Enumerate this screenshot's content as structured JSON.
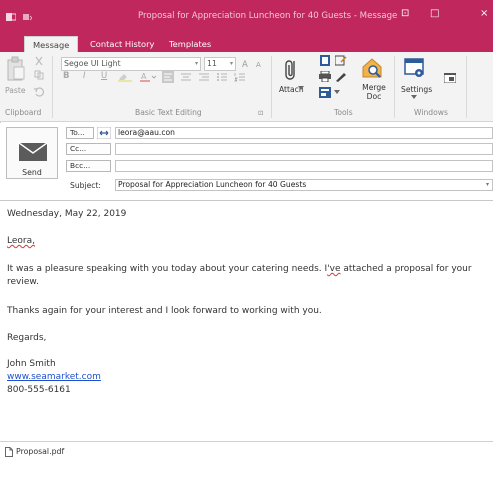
{
  "window": {
    "title": "Proposal for Appreciation Luncheon for 40 Guests - Message",
    "controls": {
      "restore": "⊡",
      "minimize": "□",
      "close": "×"
    }
  },
  "tabs": [
    "Message",
    "Contact History",
    "Templates"
  ],
  "ribbon": {
    "clipboard": {
      "paste": "Paste",
      "group": "Clipboard"
    },
    "text": {
      "font": "Segoe UI Light",
      "size": "11",
      "grow": "A",
      "shrink": "A",
      "bold": "B",
      "italic": "I",
      "underline": "U",
      "group": "Basic Text Editing",
      "launcher": "⊡"
    },
    "tools": {
      "attach": "Attach",
      "merge": "Merge Doc",
      "group": "Tools"
    },
    "windows": {
      "settings": "Settings",
      "group": "Windows"
    }
  },
  "fields": {
    "send": "Send",
    "to_label": "To...",
    "to_value": "leora@aau.con",
    "cc_label": "Cc...",
    "cc_value": "",
    "bcc_label": "Bcc...",
    "bcc_value": "",
    "subject_label": "Subject:",
    "subject_value": "Proposal for Appreciation Luncheon for 40 Guests"
  },
  "body": {
    "date": "Wednesday, May 22, 2019",
    "greeting": "Leora,",
    "p1_start": "It was a pleasure speaking with you today about your catering needs.  I",
    "p1_squiggle": "'ve",
    "p1_end": " attached a proposal for your review.",
    "p2": "Thanks again for your interest and I look forward to working with you.",
    "closing": "Regards,",
    "name": "John Smith",
    "website": "www.seamarket.com",
    "phone": "800-555-6161"
  },
  "attachment": {
    "name": "Proposal.pdf"
  }
}
